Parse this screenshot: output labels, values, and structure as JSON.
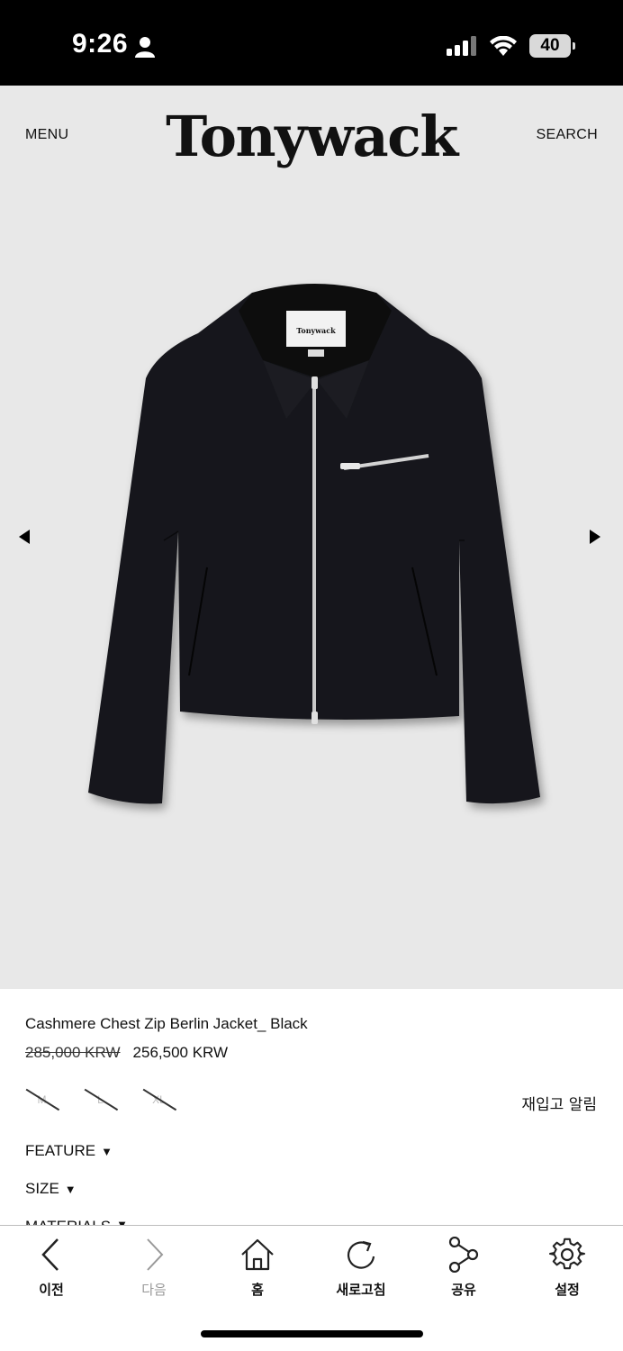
{
  "status_bar": {
    "time": "9:26",
    "battery": "40"
  },
  "header": {
    "menu_label": "MENU",
    "logo": "Tonywack",
    "search_label": "SEARCH"
  },
  "product": {
    "name": "Cashmere Chest Zip Berlin Jacket_ Black",
    "original_price": "285,000 KRW",
    "sale_price": "256,500 KRW",
    "image_label": "Tonywack",
    "sizes": [
      {
        "label": "M",
        "available": false
      },
      {
        "label": "L",
        "available": false
      },
      {
        "label": "XL",
        "available": false
      }
    ],
    "restock_label": "재입고 알림"
  },
  "accordion": [
    {
      "label": "FEATURE",
      "marker": "▼"
    },
    {
      "label": "SIZE",
      "marker": "▼"
    },
    {
      "label": "MATERIALS",
      "marker": "▼"
    }
  ],
  "toolbar": {
    "items": [
      {
        "label": "이전",
        "icon": "chevron-left-icon"
      },
      {
        "label": "다음",
        "icon": "chevron-right-icon"
      },
      {
        "label": "홈",
        "icon": "home-icon"
      },
      {
        "label": "새로고침",
        "icon": "refresh-icon"
      },
      {
        "label": "공유",
        "icon": "share-icon"
      },
      {
        "label": "설정",
        "icon": "gear-icon"
      }
    ]
  }
}
